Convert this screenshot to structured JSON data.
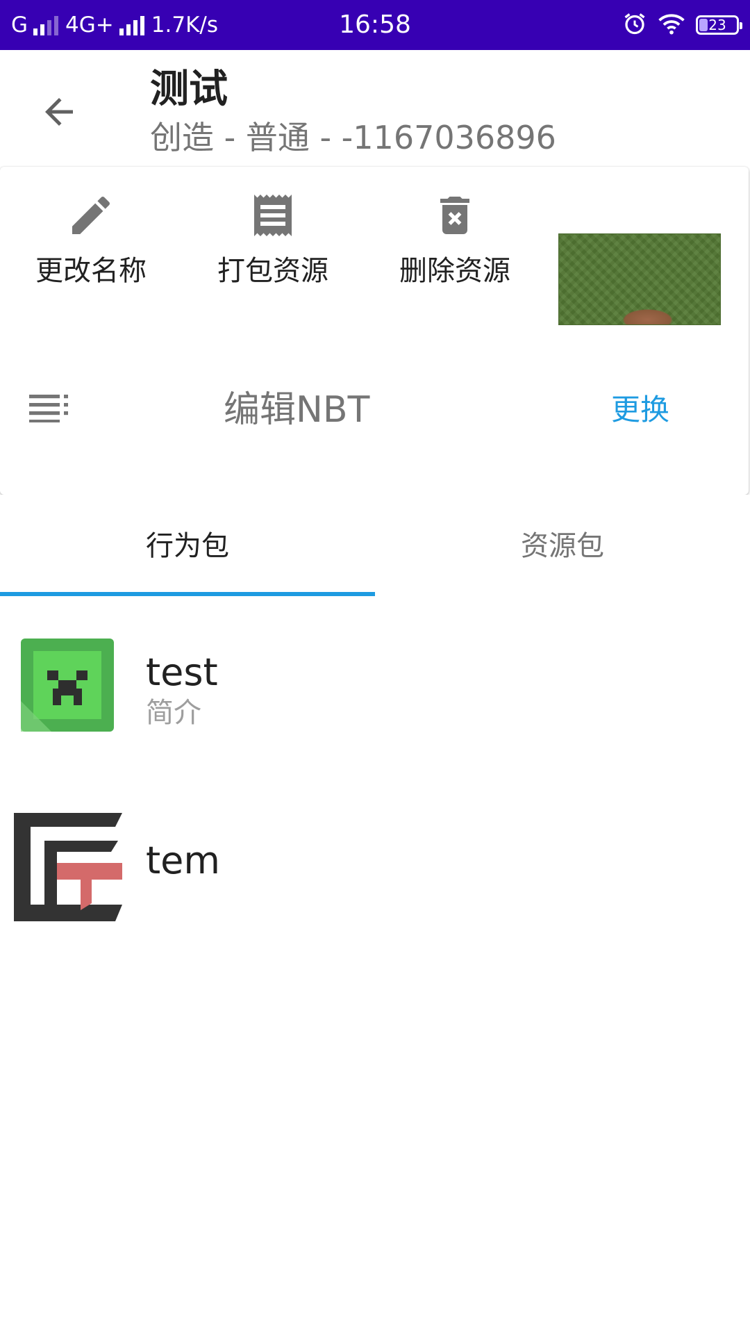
{
  "status_bar": {
    "carrier_left": "G",
    "network": "4G+",
    "speed": "1.7K/s",
    "time": "16:58",
    "battery": "23"
  },
  "toolbar": {
    "title": "测试",
    "subtitle": "创造 - 普通 - -1167036896"
  },
  "actions": [
    {
      "label": "更改名称",
      "icon": "pencil-icon"
    },
    {
      "label": "打包资源",
      "icon": "receipt-icon"
    },
    {
      "label": "删除资源",
      "icon": "delete-icon"
    }
  ],
  "nbt": {
    "label": "编辑NBT",
    "button": "更换"
  },
  "tabs": [
    {
      "label": "行为包",
      "active": true
    },
    {
      "label": "资源包",
      "active": false
    }
  ],
  "packs": [
    {
      "name": "test",
      "description": "简介",
      "icon": "creeper-pack-icon"
    },
    {
      "name": "tem",
      "description": "",
      "icon": "tem-logo-icon"
    }
  ],
  "colors": {
    "status_bar": "#3700b3",
    "accent": "#1e9be1",
    "icon_gray": "#757575"
  }
}
